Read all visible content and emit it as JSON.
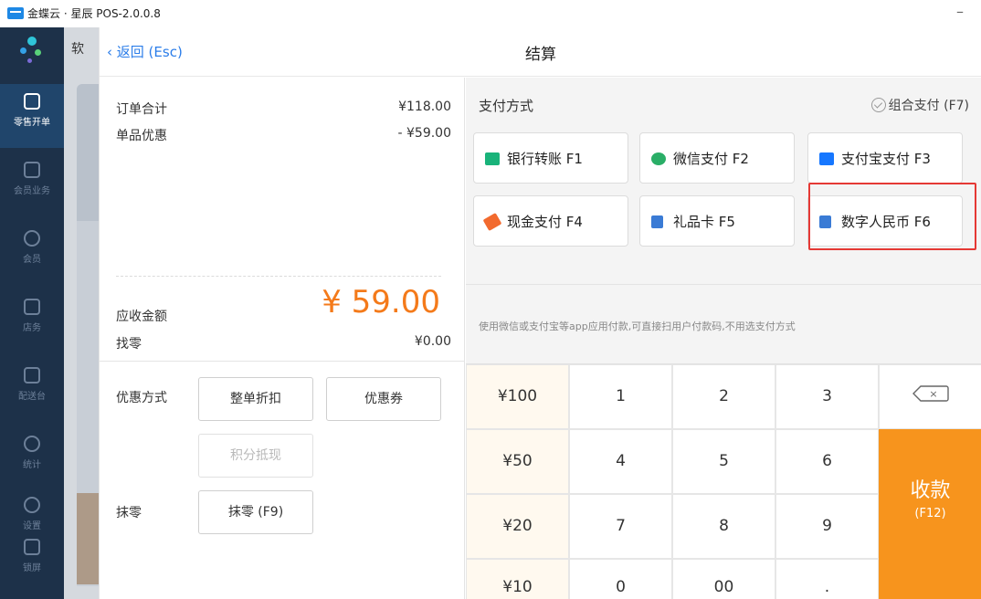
{
  "window": {
    "title": "金蝶云 · 星辰 POS-2.0.0.8",
    "minimize": "–"
  },
  "sidebar": {
    "items": [
      {
        "label": "零售开单",
        "icon": "receipt-icon"
      },
      {
        "label": "会员业务",
        "icon": "grid-icon"
      },
      {
        "label": "会员",
        "icon": "member-icon"
      },
      {
        "label": "店务",
        "icon": "store-icon"
      },
      {
        "label": "配送台",
        "icon": "delivery-icon"
      },
      {
        "label": "统计",
        "icon": "chart-icon"
      },
      {
        "label": "设置",
        "icon": "settings-icon"
      },
      {
        "label": "锁屏",
        "icon": "lock-icon"
      }
    ]
  },
  "background": {
    "tab_text": "软"
  },
  "dialog": {
    "back_label": "返回 (Esc)",
    "title": "结算",
    "order_total_label": "订单合计",
    "order_total_value": "¥118.00",
    "item_discount_label": "单品优惠",
    "item_discount_value": "- ¥59.00",
    "amount_due_label": "应收金额",
    "amount_due_value": "¥ 59.00",
    "change_label": "找零",
    "change_value": "¥0.00",
    "discount_method_label": "优惠方式",
    "whole_discount_btn": "整单折扣",
    "coupon_btn": "优惠券",
    "points_btn": "积分抵现",
    "round_off_label": "抹零",
    "round_off_btn": "抹零 (F9)"
  },
  "payment": {
    "title": "支付方式",
    "combo_label": "组合支付 (F7)",
    "methods": [
      {
        "label": "银行转账 F1",
        "icon": "bank-card-icon",
        "color": "#19b37a"
      },
      {
        "label": "微信支付 F2",
        "icon": "wechat-icon",
        "color": "#2aae67"
      },
      {
        "label": "支付宝支付 F3",
        "icon": "alipay-icon",
        "color": "#1677ff"
      },
      {
        "label": "现金支付 F4",
        "icon": "cash-tag-icon",
        "color": "#f26a2e"
      },
      {
        "label": "礼品卡 F5",
        "icon": "gift-card-icon",
        "color": "#3a7bd5"
      },
      {
        "label": "数字人民币 F6",
        "icon": "digital-rmb-icon",
        "color": "#3a7bd5"
      }
    ],
    "hint": "使用微信或支付宝等app应用付款,可直接扫用户付款码,不用选支付方式"
  },
  "keypad": {
    "amounts": [
      "¥100",
      "¥50",
      "¥20",
      "¥10"
    ],
    "row1": [
      "1",
      "2",
      "3"
    ],
    "row2": [
      "4",
      "5",
      "6"
    ],
    "row3": [
      "7",
      "8",
      "9"
    ],
    "row4": [
      "0",
      "00",
      "."
    ],
    "backspace": "×",
    "pay_label": "收款",
    "pay_shortcut": "(F12)"
  },
  "colors": {
    "accent": "#f7941d",
    "amount": "#f47a1a",
    "link": "#2b7de9",
    "highlight": "#e53935",
    "sidebar": "#1d3149"
  }
}
